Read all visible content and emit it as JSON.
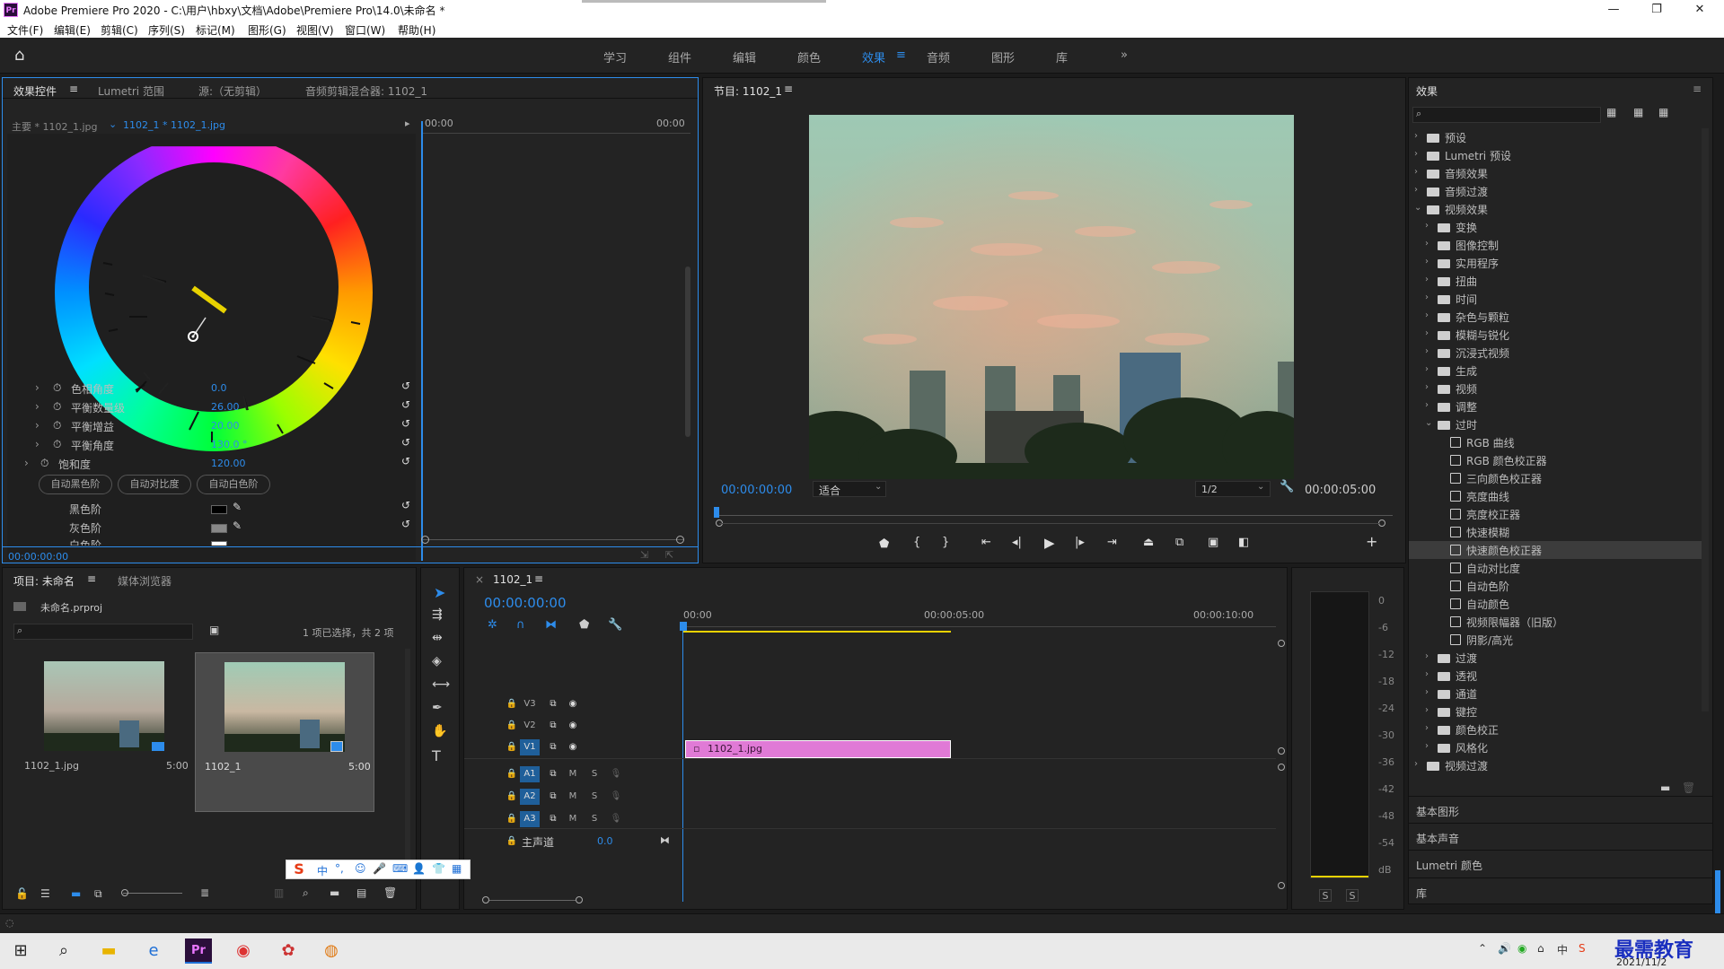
{
  "window": {
    "title": "Adobe Premiere Pro 2020 - C:\\用户\\hbxy\\文档\\Adobe\\Premiere Pro\\14.0\\未命名 *",
    "app_badge": "Pr"
  },
  "menu": [
    "文件(F)",
    "编辑(E)",
    "剪辑(C)",
    "序列(S)",
    "标记(M)",
    "图形(G)",
    "视图(V)",
    "窗口(W)",
    "帮助(H)"
  ],
  "workspaces": [
    {
      "label": "学习",
      "active": false
    },
    {
      "label": "组件",
      "active": false
    },
    {
      "label": "编辑",
      "active": false
    },
    {
      "label": "颜色",
      "active": false
    },
    {
      "label": "效果",
      "active": true
    },
    {
      "label": "音频",
      "active": false
    },
    {
      "label": "图形",
      "active": false
    },
    {
      "label": "库",
      "active": false
    }
  ],
  "effect_controls": {
    "tabs": [
      "效果控件",
      "Lumetri 范围",
      "源:（无剪辑）",
      "音频剪辑混合器: 1102_1"
    ],
    "master_label": "主要 * 1102_1.jpg",
    "clip_label": "1102_1 * 1102_1.jpg",
    "timeline_start": "00:00",
    "timeline_end": "00:00",
    "params": [
      {
        "name": "色相角度",
        "value": "0.0"
      },
      {
        "name": "平衡数量级",
        "value": "26.00"
      },
      {
        "name": "平衡增益",
        "value": "20.00"
      },
      {
        "name": "平衡角度",
        "value": "130.0 °"
      },
      {
        "name": "饱和度",
        "value": "120.00"
      }
    ],
    "auto_buttons": [
      "自动黑色阶",
      "自动对比度",
      "自动白色阶"
    ],
    "levels": [
      "黑色阶",
      "灰色阶",
      "白色阶"
    ],
    "timecode": "00:00:00:00"
  },
  "program": {
    "title": "节目: 1102_1",
    "timecode": "00:00:00:00",
    "fit": "适合",
    "resolution": "1/2",
    "duration": "00:00:05:00"
  },
  "effects_panel": {
    "title": "效果",
    "tree": [
      {
        "label": "预设",
        "level": 0,
        "type": "preset",
        "expanded": false
      },
      {
        "label": "Lumetri 预设",
        "level": 0,
        "type": "preset",
        "expanded": false
      },
      {
        "label": "音频效果",
        "level": 0,
        "type": "folder",
        "expanded": false
      },
      {
        "label": "音频过渡",
        "level": 0,
        "type": "folder",
        "expanded": false
      },
      {
        "label": "视频效果",
        "level": 0,
        "type": "folder",
        "expanded": true
      },
      {
        "label": "变换",
        "level": 1,
        "type": "folder",
        "expanded": false
      },
      {
        "label": "图像控制",
        "level": 1,
        "type": "folder",
        "expanded": false
      },
      {
        "label": "实用程序",
        "level": 1,
        "type": "folder",
        "expanded": false
      },
      {
        "label": "扭曲",
        "level": 1,
        "type": "folder",
        "expanded": false
      },
      {
        "label": "时间",
        "level": 1,
        "type": "folder",
        "expanded": false
      },
      {
        "label": "杂色与颗粒",
        "level": 1,
        "type": "folder",
        "expanded": false
      },
      {
        "label": "模糊与锐化",
        "level": 1,
        "type": "folder",
        "expanded": false
      },
      {
        "label": "沉浸式视频",
        "level": 1,
        "type": "folder",
        "expanded": false
      },
      {
        "label": "生成",
        "level": 1,
        "type": "folder",
        "expanded": false
      },
      {
        "label": "视频",
        "level": 1,
        "type": "folder",
        "expanded": false
      },
      {
        "label": "调整",
        "level": 1,
        "type": "folder",
        "expanded": false
      },
      {
        "label": "过时",
        "level": 1,
        "type": "folder",
        "expanded": true
      },
      {
        "label": "RGB 曲线",
        "level": 2,
        "type": "effect"
      },
      {
        "label": "RGB 颜色校正器",
        "level": 2,
        "type": "effect"
      },
      {
        "label": "三向颜色校正器",
        "level": 2,
        "type": "effect"
      },
      {
        "label": "亮度曲线",
        "level": 2,
        "type": "effect"
      },
      {
        "label": "亮度校正器",
        "level": 2,
        "type": "effect"
      },
      {
        "label": "快速模糊",
        "level": 2,
        "type": "effect"
      },
      {
        "label": "快速颜色校正器",
        "level": 2,
        "type": "effect",
        "selected": true
      },
      {
        "label": "自动对比度",
        "level": 2,
        "type": "effect"
      },
      {
        "label": "自动色阶",
        "level": 2,
        "type": "effect"
      },
      {
        "label": "自动颜色",
        "level": 2,
        "type": "effect"
      },
      {
        "label": "视频限幅器（旧版）",
        "level": 2,
        "type": "effect"
      },
      {
        "label": "阴影/高光",
        "level": 2,
        "type": "effect"
      },
      {
        "label": "过渡",
        "level": 1,
        "type": "folder",
        "expanded": false
      },
      {
        "label": "透视",
        "level": 1,
        "type": "folder",
        "expanded": false
      },
      {
        "label": "通道",
        "level": 1,
        "type": "folder",
        "expanded": false
      },
      {
        "label": "键控",
        "level": 1,
        "type": "folder",
        "expanded": false
      },
      {
        "label": "颜色校正",
        "level": 1,
        "type": "folder",
        "expanded": false
      },
      {
        "label": "风格化",
        "level": 1,
        "type": "folder",
        "expanded": false
      },
      {
        "label": "视频过渡",
        "level": 0,
        "type": "folder",
        "expanded": false
      }
    ],
    "bottom_sections": [
      "基本图形",
      "基本声音",
      "Lumetri 颜色",
      "库"
    ]
  },
  "project": {
    "tabs": [
      "项目: 未命名",
      "媒体浏览器"
    ],
    "file": "未命名.prproj",
    "selection": "1 项已选择，共 2 项",
    "items": [
      {
        "name": "1102_1.jpg",
        "duration": "5:00"
      },
      {
        "name": "1102_1",
        "duration": "5:00"
      }
    ]
  },
  "timeline": {
    "title": "1102_1",
    "timecode": "00:00:00:00",
    "ruler": [
      "00:00",
      "00:00:05:00",
      "00:00:10:00"
    ],
    "video_tracks": [
      "V3",
      "V2",
      "V1"
    ],
    "audio_tracks": [
      "A1",
      "A2",
      "A3"
    ],
    "master_label": "主声道",
    "master_value": "0.0",
    "clip_label": "1102_1.jpg"
  },
  "meter": {
    "scale": [
      "0",
      "-6",
      "-12",
      "-18",
      "-24",
      "-30",
      "-36",
      "-42",
      "-48",
      "-54",
      "dB"
    ],
    "solo": [
      "S",
      "S"
    ]
  },
  "ime": {
    "label": "中"
  },
  "tray": {
    "date": "2021/11/2",
    "watermark": "最需教育"
  },
  "colors": {
    "accent": "#2d8ceb",
    "clip": "#e07ad6",
    "selection": "#3c3c3c"
  }
}
